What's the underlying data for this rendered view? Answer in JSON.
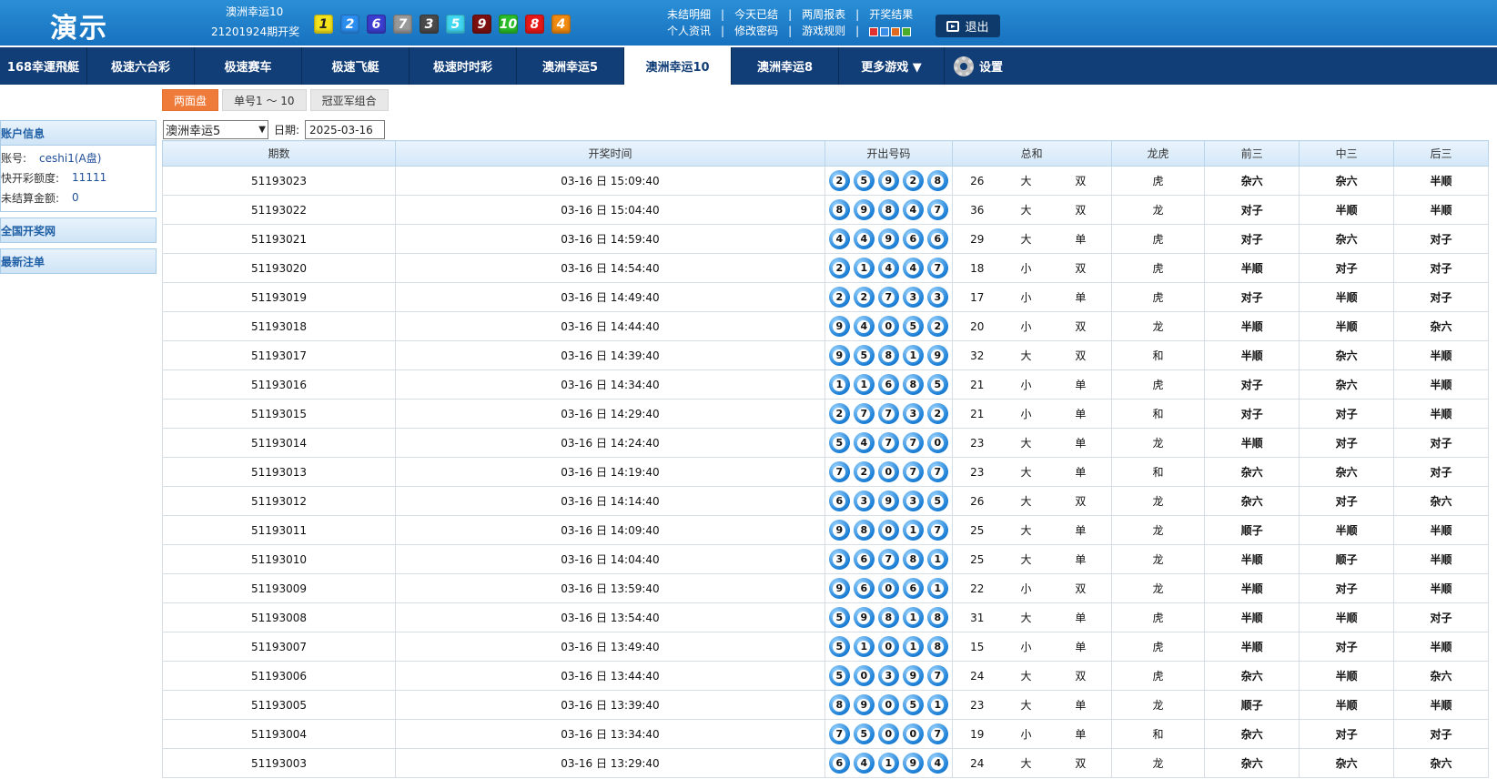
{
  "header": {
    "logo": "演示",
    "lottery_name": "澳洲幸运10",
    "period_text": "21201924期开奖",
    "last_draw": [
      {
        "n": "1",
        "bg": "#f5e31c",
        "fg": "#222"
      },
      {
        "n": "2",
        "bg": "#2b8ef0",
        "fg": "#fff"
      },
      {
        "n": "6",
        "bg": "#3c3ed0",
        "fg": "#fff"
      },
      {
        "n": "7",
        "bg": "#9a9a9a",
        "fg": "#fff"
      },
      {
        "n": "3",
        "bg": "#4a4a4a",
        "fg": "#fff"
      },
      {
        "n": "5",
        "bg": "#3fd6f0",
        "fg": "#fff"
      },
      {
        "n": "9",
        "bg": "#7d1010",
        "fg": "#fff"
      },
      {
        "n": "10",
        "bg": "#2bbd2b",
        "fg": "#fff"
      },
      {
        "n": "8",
        "bg": "#e81818",
        "fg": "#fff"
      },
      {
        "n": "4",
        "bg": "#f08a10",
        "fg": "#fff"
      }
    ],
    "links_row1": [
      "未结明细",
      "今天已结",
      "两周报表",
      "开奖结果"
    ],
    "links_row2": [
      "个人资讯",
      "修改密码",
      "游戏规则"
    ],
    "skins": [
      "#e03030",
      "#3a8ee6",
      "#e06a20",
      "#4caa2a"
    ],
    "logout_label": "退出"
  },
  "nav": {
    "items": [
      "168幸運飛艇",
      "极速六合彩",
      "极速赛车",
      "极速飞艇",
      "极速时时彩",
      "澳洲幸运5",
      "澳洲幸运10",
      "澳洲幸运8",
      "更多游戏 ▼"
    ],
    "active_index": 6,
    "settings_label": "设置"
  },
  "subtabs": [
    "两面盘",
    "单号1 ～ 10",
    "冠亚军组合"
  ],
  "sidebar": {
    "account_title": "账户信息",
    "account_rows": [
      {
        "label": "账号:",
        "value": "ceshi1(A盘)"
      },
      {
        "label": "快开彩额度:",
        "value": "11111"
      },
      {
        "label": "未结算金额:",
        "value": "0"
      }
    ],
    "national_title": "全国开奖网",
    "latest_title": "最新注单"
  },
  "filter": {
    "lottery": "澳洲幸运5",
    "date_label": "日期:",
    "date_value": "2025-03-16"
  },
  "table": {
    "headers": [
      "期数",
      "开奖时间",
      "开出号码",
      "总和",
      "龙虎",
      "前三",
      "中三",
      "后三"
    ],
    "rows": [
      {
        "issue": "51193023",
        "time": "03-16 日 15:09:40",
        "balls": [
          "2",
          "5",
          "9",
          "2",
          "8"
        ],
        "sum": "26",
        "size": "大",
        "parity": "双",
        "dt": "虎",
        "q": "杂六",
        "z": "杂六",
        "h": "半顺"
      },
      {
        "issue": "51193022",
        "time": "03-16 日 15:04:40",
        "balls": [
          "8",
          "9",
          "8",
          "4",
          "7"
        ],
        "sum": "36",
        "size": "大",
        "parity": "双",
        "dt": "龙",
        "q": "对子",
        "z": "半顺",
        "h": "半顺"
      },
      {
        "issue": "51193021",
        "time": "03-16 日 14:59:40",
        "balls": [
          "4",
          "4",
          "9",
          "6",
          "6"
        ],
        "sum": "29",
        "size": "大",
        "parity": "单",
        "dt": "虎",
        "q": "对子",
        "z": "杂六",
        "h": "对子"
      },
      {
        "issue": "51193020",
        "time": "03-16 日 14:54:40",
        "balls": [
          "2",
          "1",
          "4",
          "4",
          "7"
        ],
        "sum": "18",
        "size": "小",
        "parity": "双",
        "dt": "虎",
        "q": "半顺",
        "z": "对子",
        "h": "对子"
      },
      {
        "issue": "51193019",
        "time": "03-16 日 14:49:40",
        "balls": [
          "2",
          "2",
          "7",
          "3",
          "3"
        ],
        "sum": "17",
        "size": "小",
        "parity": "单",
        "dt": "虎",
        "q": "对子",
        "z": "半顺",
        "h": "对子"
      },
      {
        "issue": "51193018",
        "time": "03-16 日 14:44:40",
        "balls": [
          "9",
          "4",
          "0",
          "5",
          "2"
        ],
        "sum": "20",
        "size": "小",
        "parity": "双",
        "dt": "龙",
        "q": "半顺",
        "z": "半顺",
        "h": "杂六"
      },
      {
        "issue": "51193017",
        "time": "03-16 日 14:39:40",
        "balls": [
          "9",
          "5",
          "8",
          "1",
          "9"
        ],
        "sum": "32",
        "size": "大",
        "parity": "双",
        "dt": "和",
        "q": "半顺",
        "z": "杂六",
        "h": "半顺"
      },
      {
        "issue": "51193016",
        "time": "03-16 日 14:34:40",
        "balls": [
          "1",
          "1",
          "6",
          "8",
          "5"
        ],
        "sum": "21",
        "size": "小",
        "parity": "单",
        "dt": "虎",
        "q": "对子",
        "z": "杂六",
        "h": "半顺"
      },
      {
        "issue": "51193015",
        "time": "03-16 日 14:29:40",
        "balls": [
          "2",
          "7",
          "7",
          "3",
          "2"
        ],
        "sum": "21",
        "size": "小",
        "parity": "单",
        "dt": "和",
        "q": "对子",
        "z": "对子",
        "h": "半顺"
      },
      {
        "issue": "51193014",
        "time": "03-16 日 14:24:40",
        "balls": [
          "5",
          "4",
          "7",
          "7",
          "0"
        ],
        "sum": "23",
        "size": "大",
        "parity": "单",
        "dt": "龙",
        "q": "半顺",
        "z": "对子",
        "h": "对子"
      },
      {
        "issue": "51193013",
        "time": "03-16 日 14:19:40",
        "balls": [
          "7",
          "2",
          "0",
          "7",
          "7"
        ],
        "sum": "23",
        "size": "大",
        "parity": "单",
        "dt": "和",
        "q": "杂六",
        "z": "杂六",
        "h": "对子"
      },
      {
        "issue": "51193012",
        "time": "03-16 日 14:14:40",
        "balls": [
          "6",
          "3",
          "9",
          "3",
          "5"
        ],
        "sum": "26",
        "size": "大",
        "parity": "双",
        "dt": "龙",
        "q": "杂六",
        "z": "对子",
        "h": "杂六"
      },
      {
        "issue": "51193011",
        "time": "03-16 日 14:09:40",
        "balls": [
          "9",
          "8",
          "0",
          "1",
          "7"
        ],
        "sum": "25",
        "size": "大",
        "parity": "单",
        "dt": "龙",
        "q": "顺子",
        "z": "半顺",
        "h": "半顺"
      },
      {
        "issue": "51193010",
        "time": "03-16 日 14:04:40",
        "balls": [
          "3",
          "6",
          "7",
          "8",
          "1"
        ],
        "sum": "25",
        "size": "大",
        "parity": "单",
        "dt": "龙",
        "q": "半顺",
        "z": "顺子",
        "h": "半顺"
      },
      {
        "issue": "51193009",
        "time": "03-16 日 13:59:40",
        "balls": [
          "9",
          "6",
          "0",
          "6",
          "1"
        ],
        "sum": "22",
        "size": "小",
        "parity": "双",
        "dt": "龙",
        "q": "半顺",
        "z": "对子",
        "h": "半顺"
      },
      {
        "issue": "51193008",
        "time": "03-16 日 13:54:40",
        "balls": [
          "5",
          "9",
          "8",
          "1",
          "8"
        ],
        "sum": "31",
        "size": "大",
        "parity": "单",
        "dt": "虎",
        "q": "半顺",
        "z": "半顺",
        "h": "对子"
      },
      {
        "issue": "51193007",
        "time": "03-16 日 13:49:40",
        "balls": [
          "5",
          "1",
          "0",
          "1",
          "8"
        ],
        "sum": "15",
        "size": "小",
        "parity": "单",
        "dt": "虎",
        "q": "半顺",
        "z": "对子",
        "h": "半顺"
      },
      {
        "issue": "51193006",
        "time": "03-16 日 13:44:40",
        "balls": [
          "5",
          "0",
          "3",
          "9",
          "7"
        ],
        "sum": "24",
        "size": "大",
        "parity": "双",
        "dt": "虎",
        "q": "杂六",
        "z": "半顺",
        "h": "杂六"
      },
      {
        "issue": "51193005",
        "time": "03-16 日 13:39:40",
        "balls": [
          "8",
          "9",
          "0",
          "5",
          "1"
        ],
        "sum": "23",
        "size": "大",
        "parity": "单",
        "dt": "龙",
        "q": "顺子",
        "z": "半顺",
        "h": "半顺"
      },
      {
        "issue": "51193004",
        "time": "03-16 日 13:34:40",
        "balls": [
          "7",
          "5",
          "0",
          "0",
          "7"
        ],
        "sum": "19",
        "size": "小",
        "parity": "单",
        "dt": "和",
        "q": "杂六",
        "z": "对子",
        "h": "对子"
      },
      {
        "issue": "51193003",
        "time": "03-16 日 13:29:40",
        "balls": [
          "6",
          "4",
          "1",
          "9",
          "4"
        ],
        "sum": "24",
        "size": "大",
        "parity": "双",
        "dt": "龙",
        "q": "杂六",
        "z": "杂六",
        "h": "杂六"
      }
    ]
  },
  "colors": {
    "big": "#e00000",
    "odd": "#e00000",
    "dragon": "#e00000",
    "tie": "#0000e0",
    "accent": "#ef7b3a",
    "nav": "#123e78"
  }
}
